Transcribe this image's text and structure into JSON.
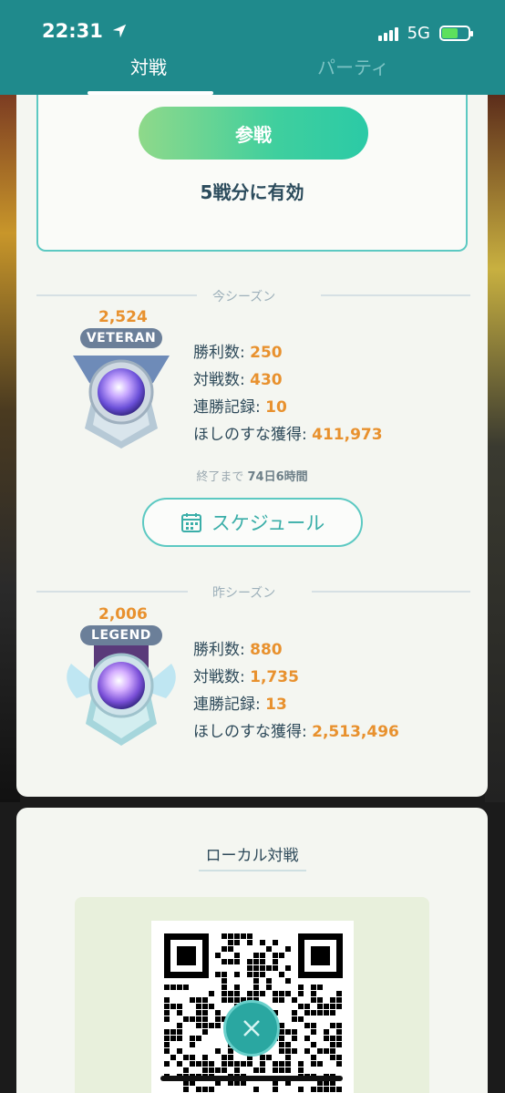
{
  "status_bar": {
    "time": "22:31",
    "network": "5G"
  },
  "tabs": {
    "battle": "対戦",
    "party": "パーティ"
  },
  "entry": {
    "join_label": "参戦",
    "valid_text": "5戦分に有効"
  },
  "current_season": {
    "label": "今シーズン",
    "rating": "2,524",
    "rank": "VETERAN",
    "stats": {
      "wins_label": "勝利数:",
      "wins": "250",
      "battles_label": "対戦数:",
      "battles": "430",
      "streak_label": "連勝記録:",
      "streak": "10",
      "stardust_label": "ほしのすな獲得:",
      "stardust": "411,973"
    },
    "ends_prefix": "終了まで",
    "ends_value": "74日6時間",
    "schedule_label": "スケジュール"
  },
  "previous_season": {
    "label": "昨シーズン",
    "rating": "2,006",
    "rank": "LEGEND",
    "stats": {
      "wins_label": "勝利数:",
      "wins": "880",
      "battles_label": "対戦数:",
      "battles": "1,735",
      "streak_label": "連勝記録:",
      "streak": "13",
      "stardust_label": "ほしのすな獲得:",
      "stardust": "2,513,496"
    }
  },
  "local_battle": {
    "title": "ローカル対戦"
  },
  "colors": {
    "header": "#1f8a8c",
    "accent": "#5cc9c2",
    "value": "#e8912e"
  }
}
